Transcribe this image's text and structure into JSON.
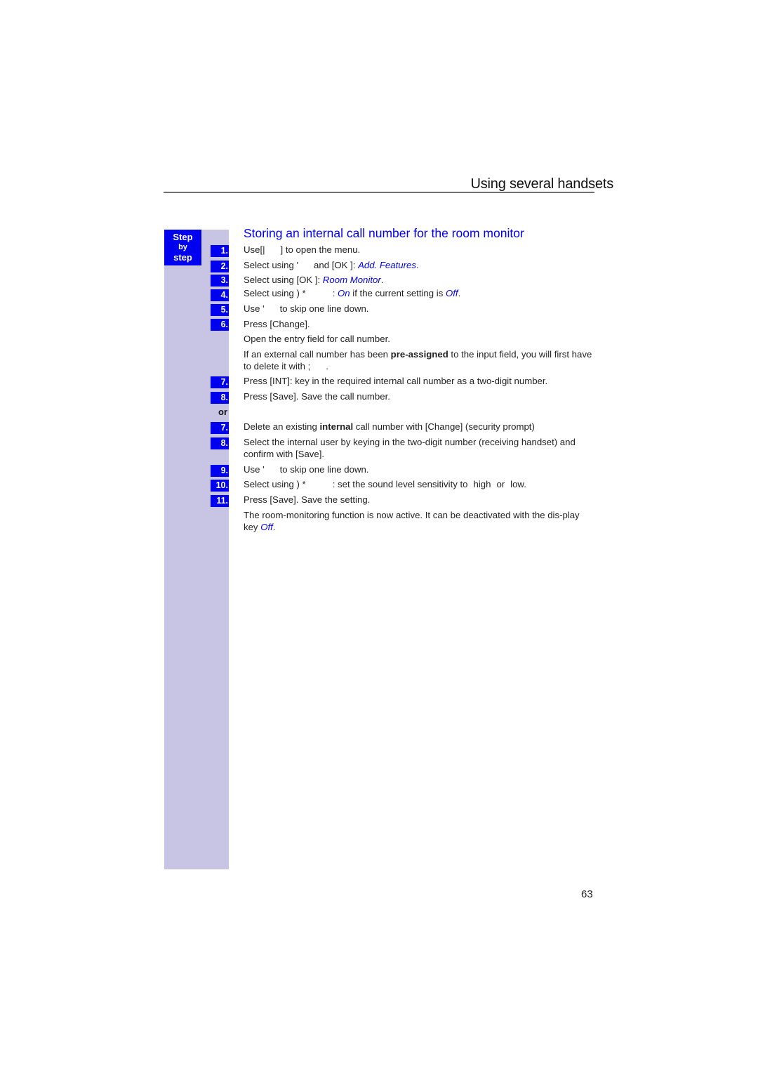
{
  "header": {
    "title": "Using several handsets"
  },
  "sidebar": {
    "badge": {
      "line1": "Step",
      "line2": "by",
      "line3": "step"
    },
    "or_label": "or",
    "accent_color": "#0000f0",
    "band_color": "#c7c5e3"
  },
  "section": {
    "title": "Storing an internal call number for the room monitor"
  },
  "steps": {
    "s1": {
      "num": "1.",
      "pre": "Use[|",
      "post": "] to open the menu."
    },
    "s2": {
      "num": "2.",
      "pre": "Select using '",
      "mid": "and [OK ]: ",
      "value": "Add. Features",
      "post": "."
    },
    "s3": {
      "num": "3.",
      "pre": "Select using [OK ]: ",
      "value": "Room Monitor",
      "post": "."
    },
    "s4": {
      "num": "4.",
      "pre": "Select using ) *",
      "mid": ": ",
      "value": "On",
      "mid2": " if the current setting is ",
      "value2": "Off",
      "post": "."
    },
    "s5": {
      "num": "5.",
      "pre": "Use '",
      "post": "to skip one line down."
    },
    "s6": {
      "num": "6.",
      "text": "Press [Change]."
    },
    "s6_note1": "Open the entry field for call number.",
    "s6_note2": {
      "pre": "If an external call number has been ",
      "bold": "pre-assigned",
      "post": " to the input field, you will first have to delete it with ;",
      "end": "."
    },
    "s7a": {
      "num": "7.",
      "text": "Press [INT]: key in the required internal call number as a two-digit number."
    },
    "s8a": {
      "num": "8.",
      "text": "Press [Save]. Save the call number."
    },
    "s7b": {
      "num": "7.",
      "pre": "Delete an existing ",
      "bold": "internal",
      "post": " call number with [Change] (security prompt)"
    },
    "s8b": {
      "num": "8.",
      "text": "Select the internal user by keying in the two-digit number (receiving handset) and confirm with [Save]."
    },
    "s9": {
      "num": "9.",
      "pre": "Use '",
      "post": "to skip one line down."
    },
    "s10": {
      "num": "10.",
      "pre": "Select using ) *",
      "post": ": set the sound level sensitivity to",
      "opt1": "high",
      "or": "or",
      "opt2": "low",
      "end": "."
    },
    "s11": {
      "num": "11.",
      "text": "Press [Save]. Save the setting."
    },
    "closing": {
      "pre": "The room-monitoring function is now active. It can be deactivated with the dis-play key ",
      "value": "Off",
      "post": "."
    }
  },
  "footer": {
    "page_number": "63"
  }
}
